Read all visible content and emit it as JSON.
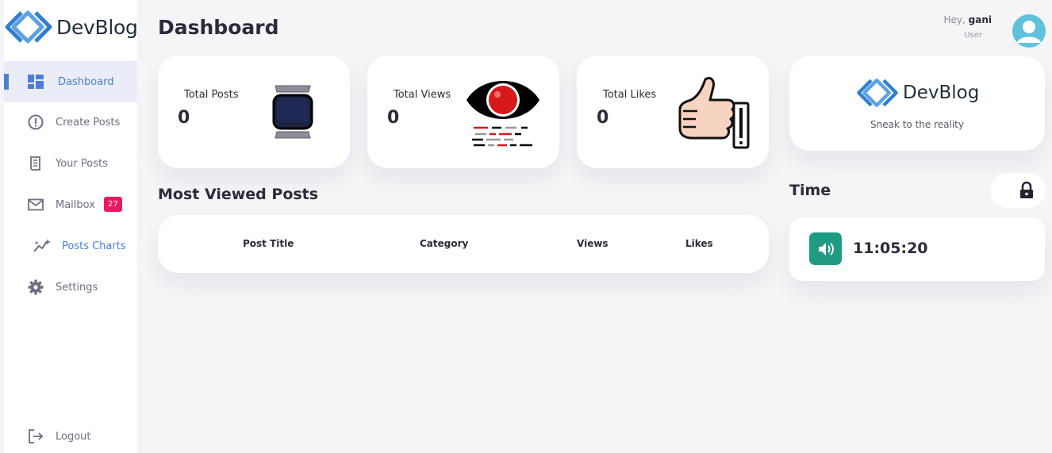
{
  "brand": {
    "name": "DevBlog",
    "tagline": "Sneak to the reality"
  },
  "page": {
    "title": "Dashboard"
  },
  "user": {
    "greeting": "Hey,",
    "name": "gani",
    "role": "User"
  },
  "sidebar": {
    "items": [
      {
        "label": "Dashboard",
        "icon": "dashboard-icon",
        "active": true
      },
      {
        "label": "Create Posts",
        "icon": "alert-circle-icon"
      },
      {
        "label": "Your Posts",
        "icon": "posts-list-icon"
      },
      {
        "label": "Mailbox",
        "icon": "mail-icon",
        "badge": "27"
      },
      {
        "label": "Posts Charts",
        "icon": "chart-sparkle-icon"
      },
      {
        "label": "Settings",
        "icon": "gear-icon"
      }
    ],
    "logout": {
      "label": "Logout",
      "icon": "logout-icon"
    }
  },
  "stats": [
    {
      "label": "Total Posts",
      "value": "0",
      "icon": "posts-device-icon"
    },
    {
      "label": "Total Views",
      "value": "0",
      "icon": "eye-icon"
    },
    {
      "label": "Total Likes",
      "value": "0",
      "icon": "thumbs-up-icon"
    }
  ],
  "most_viewed": {
    "title": "Most Viewed Posts",
    "columns": [
      "Post Title",
      "Category",
      "Views",
      "Likes"
    ]
  },
  "time": {
    "title": "Time",
    "value": "11:05:20",
    "lock_icon": "lock-icon",
    "speaker_icon": "speaker-icon"
  },
  "colors": {
    "accent": "#4a7ed9",
    "badge": "#ef1860",
    "speaker": "#1f9a83",
    "avatar": "#5ec2dc"
  }
}
